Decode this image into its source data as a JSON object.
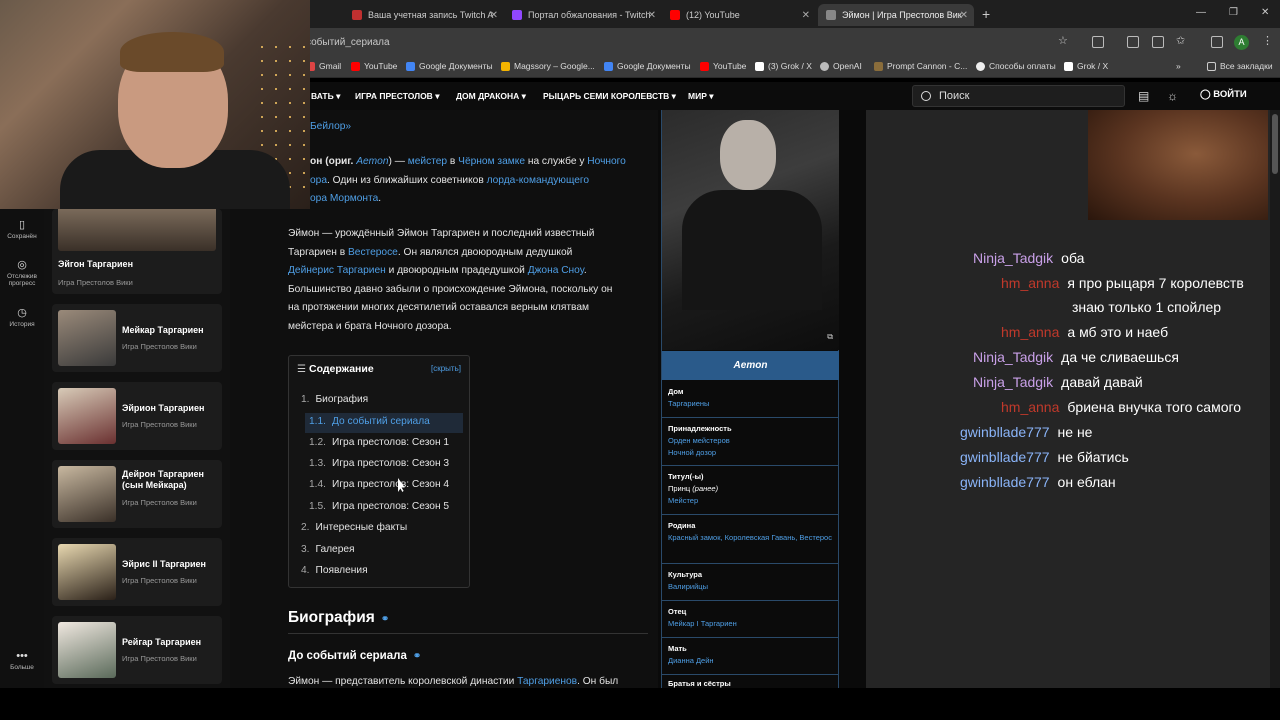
{
  "browser": {
    "tabs": [
      {
        "label": "Ваша учетная запись Twitch A",
        "color": "#c03030"
      },
      {
        "label": "Портал обжалования - Twitch",
        "color": "#9147ff"
      },
      {
        "label": "(12) YouTube",
        "color": "#ff0000"
      },
      {
        "label": "Эймон | Игра Престолов Вик",
        "color": "#888888"
      }
    ],
    "url": "событий_сериала",
    "bookmarks": [
      "Gmail",
      "YouTube",
      "Google Документы",
      "Magssory – Google...",
      "Google Документы",
      "YouTube",
      "(3) Grok / X",
      "OpenAI",
      "Prompt Cannon - C...",
      "Способы оплаты",
      "Grok / X"
    ],
    "all_bookmarks": "Все закладки",
    "avatar": "A"
  },
  "site_nav": {
    "items": [
      "ВАТЬ",
      "ИГРА ПРЕСТОЛОВ",
      "ДОМ ДРАКОНА",
      "РЫЦАРЬ СЕМИ КОРОЛЕВСТВ",
      "МИР"
    ],
    "search_placeholder": "Поиск",
    "login": "ВОЙТИ"
  },
  "rail": {
    "saved": "Сохранён",
    "progress": "Отслежив прогресс",
    "history": "История",
    "more": "Больше"
  },
  "related": [
    {
      "name": "Эйгон Таргариен",
      "source": "Игра Престолов Вики"
    },
    {
      "name": "Мейкар Таргариен",
      "source": "Игра Престолов Вики"
    },
    {
      "name": "Эйрион Таргариен",
      "source": "Игра Престолов Вики"
    },
    {
      "name": "Дейрон Таргариен (сын Мейкара)",
      "source": "Игра Престолов Вики"
    },
    {
      "name": "Эйрис II Таргариен",
      "source": "Игра Престолов Вики"
    },
    {
      "name": "Рейгар Таргариен",
      "source": "Игра Престолов Вики"
    }
  ],
  "article": {
    "line0": "Бейлор»",
    "p1": {
      "a": "он (ориг. ",
      "aemon": "Aemon",
      "b": ") — ",
      "maester": "мейстер",
      "c": " в ",
      "castle": "Чёрном замке",
      "d": " на службе у ",
      "watch": "Ночного",
      "l2a": "ора",
      "l2b": ". Один из ближайших советников ",
      "lord": "лорда-командующего",
      "l3a": "ора Мормонта",
      "l3b": "."
    },
    "p2": {
      "l1": "Эймон — урождённый Эймон Таргариен и последний известный",
      "l2a": "Таргариен в ",
      "westeros": "Вестеросе",
      "l2b": ". Он являлся двоюродным дедушкой",
      "daenerys": "Дейнерис Таргариен",
      "l3b": " и двоюродным прадедушкой ",
      "jon": "Джона Сноу",
      "l3c": ".",
      "l4": "Большинство давно забыли о происхождение Эймона, поскольку он",
      "l5": "на протяжении многих десятилетий оставался верным клятвам",
      "l6": "мейстера и брата Ночного дозора."
    },
    "toc": {
      "title": "Содержание",
      "hide": "скрыть",
      "items": [
        {
          "n": "1.",
          "t": "Биография"
        },
        {
          "n": "1.1.",
          "t": "До событий сериала"
        },
        {
          "n": "1.2.",
          "t": "Игра престолов: Сезон 1"
        },
        {
          "n": "1.3.",
          "t": "Игра престолов: Сезон 3"
        },
        {
          "n": "1.4.",
          "t": "Игра престолов: Сезон 4"
        },
        {
          "n": "1.5.",
          "t": "Игра престолов: Сезон 5"
        },
        {
          "n": "2.",
          "t": "Интересные факты"
        },
        {
          "n": "3.",
          "t": "Галерея"
        },
        {
          "n": "4.",
          "t": "Появления"
        }
      ]
    },
    "bio_heading": "Биография",
    "sub_heading": "До событий сериала",
    "last_line_a": "Эймон — представитель королевской династии ",
    "last_link": "Таргариенов",
    "last_line_b": ". Он был"
  },
  "infobox": {
    "caption": "Aemon",
    "house_lbl": "Дом",
    "house": "Таргариены",
    "aff_lbl": "Принадлежность",
    "aff1": "Орден мейстеров",
    "aff2": "Ночной дозор",
    "title_lbl": "Титул(-ы)",
    "title1": "Принц ",
    "title1b": "(ранее)",
    "title2": "Мейстер",
    "home_lbl": "Родина",
    "home": "Красный замок, Королевская Гавань, Вестерос",
    "culture_lbl": "Культура",
    "culture": "Валирийцы",
    "father_lbl": "Отец",
    "father": "Мейкар I Таргариен",
    "mother_lbl": "Мать",
    "mother": "Дианна Дейн",
    "sib_lbl": "Братья и сёстры"
  },
  "chat": [
    {
      "user": "Ninja_Tadgik",
      "color": "#c9a0e8",
      "msg": "оба"
    },
    {
      "user": "hm_anna",
      "color": "#c0392b",
      "msg": "я про рыцаря 7 королевств"
    },
    {
      "user": "",
      "color": "#ffffff",
      "msg": "знаю только 1 спойлер"
    },
    {
      "user": "hm_anna",
      "color": "#c0392b",
      "msg": "а мб это и наеб"
    },
    {
      "user": "Ninja_Tadgik",
      "color": "#c9a0e8",
      "msg": "да че сливаешься"
    },
    {
      "user": "Ninja_Tadgik",
      "color": "#c9a0e8",
      "msg": "давай давай"
    },
    {
      "user": "hm_anna",
      "color": "#c0392b",
      "msg": "бриена внучка того самого"
    },
    {
      "user": "gwinbllade777",
      "color": "#8ab4f8",
      "msg": "не не"
    },
    {
      "user": "gwinbllade777",
      "color": "#8ab4f8",
      "msg": "не бйатись"
    },
    {
      "user": "gwinbllade777",
      "color": "#8ab4f8",
      "msg": "он еблан"
    }
  ]
}
